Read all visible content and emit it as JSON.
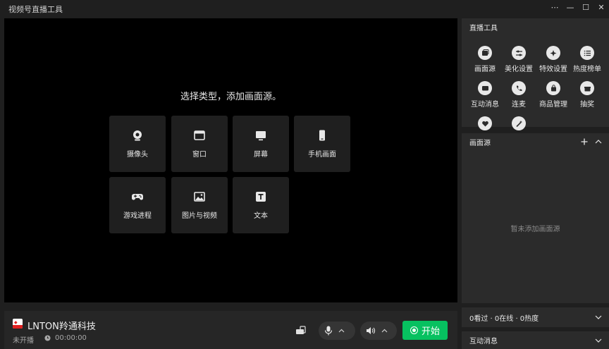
{
  "app": {
    "title": "视频号直播工具"
  },
  "window_controls": {
    "more": "⋯",
    "minimize": "—",
    "maximize": "☐",
    "close": "✕"
  },
  "preview": {
    "prompt": "选择类型，添加画面源。",
    "sources": [
      {
        "label": "摄像头",
        "icon": "camera-icon"
      },
      {
        "label": "窗口",
        "icon": "window-icon"
      },
      {
        "label": "屏幕",
        "icon": "monitor-icon"
      },
      {
        "label": "手机画面",
        "icon": "phone-icon"
      },
      {
        "label": "游戏进程",
        "icon": "gamepad-icon"
      },
      {
        "label": "图片与视频",
        "icon": "image-icon"
      },
      {
        "label": "文本",
        "icon": "text-icon"
      }
    ]
  },
  "bottom": {
    "brand_name": "LNTON羚通科技",
    "status": "未开播",
    "timer": "00:00:00",
    "start_label": "开始",
    "accent": "#07c160"
  },
  "tools": {
    "title": "直播工具",
    "items": [
      {
        "label": "画面源",
        "icon": "source-icon"
      },
      {
        "label": "美化设置",
        "icon": "sliders-icon"
      },
      {
        "label": "特效设置",
        "icon": "sparkle-icon"
      },
      {
        "label": "热度榜单",
        "icon": "list-icon"
      },
      {
        "label": "互动消息",
        "icon": "message-icon"
      },
      {
        "label": "连麦",
        "icon": "call-icon"
      },
      {
        "label": "商品管理",
        "icon": "shopping-bag-icon"
      },
      {
        "label": "抽奖",
        "icon": "gift-icon"
      },
      {
        "label": "",
        "icon": "heart-icon"
      },
      {
        "label": "",
        "icon": "wand-icon"
      }
    ]
  },
  "sources_panel": {
    "title": "画面源",
    "empty": "暂未添加画面源"
  },
  "stats": {
    "text": "0看过 · 0在线 · 0热度"
  },
  "interaction": {
    "title": "互动消息"
  }
}
